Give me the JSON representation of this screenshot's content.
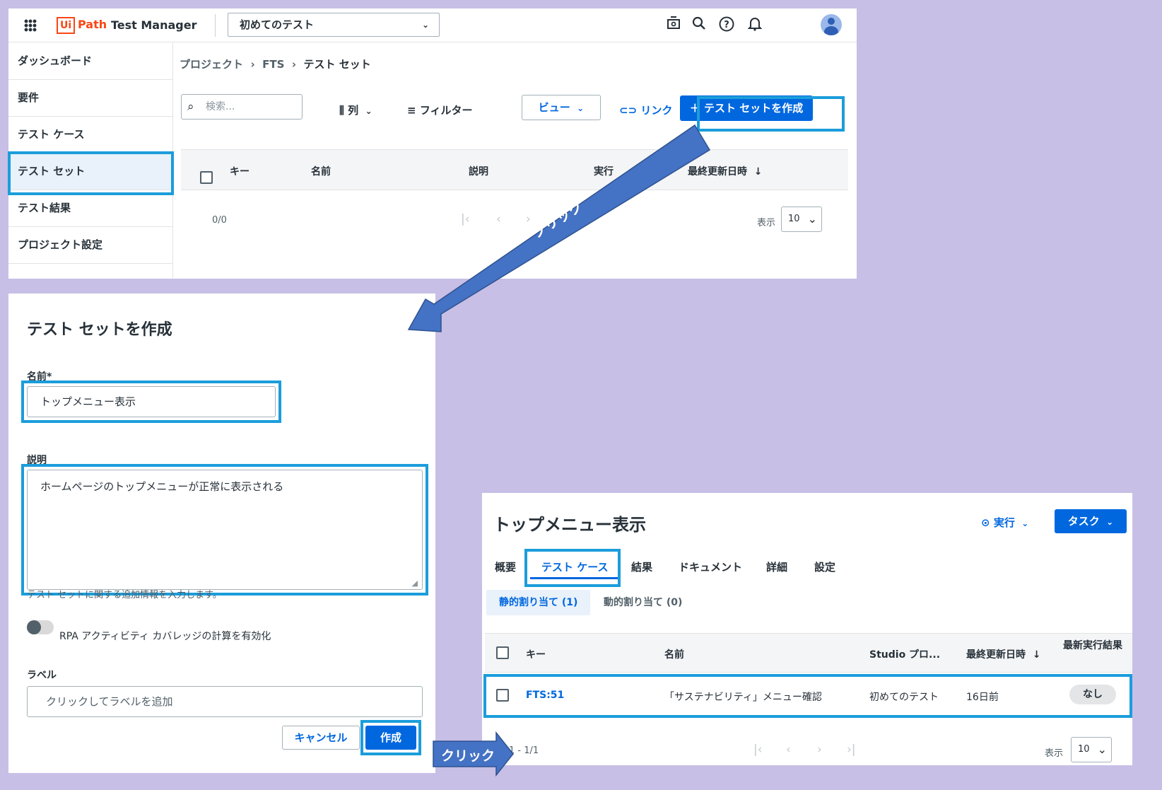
{
  "app": {
    "logo_ui": "Ui",
    "logo_path": "Path",
    "product": "Test Manager",
    "project_select": "初めてのテスト"
  },
  "icons": {
    "apps": "grid-icon",
    "store": "store-icon",
    "search": "search-icon",
    "help": "help-icon",
    "bell": "bell-icon",
    "avatar": "user-avatar-icon"
  },
  "colors": {
    "brand": "#fa4616",
    "primary": "#0067df",
    "highlight": "#1b9ddb",
    "arrow": "#4472c4",
    "background": "#c8bfe6"
  },
  "sidebar": {
    "items": [
      {
        "label": "ダッシュボード"
      },
      {
        "label": "要件"
      },
      {
        "label": "テスト ケース"
      },
      {
        "label": "テスト セット",
        "active": true
      },
      {
        "label": "テスト結果"
      },
      {
        "label": "プロジェクト設定"
      }
    ]
  },
  "testsets_page": {
    "breadcrumb": [
      "プロジェクト",
      "FTS",
      "テスト セット"
    ],
    "search_placeholder": "検索...",
    "columns_label": "列",
    "filter_label": "フィルター",
    "view_label": "ビュー",
    "link_label": "リンク",
    "create_label": "テスト セットを作成",
    "table_headers": [
      "キー",
      "名前",
      "説明",
      "実行",
      "最終更新日時"
    ],
    "pagination": {
      "range": "0/0",
      "rows_label": "表示",
      "rows_value": "10"
    }
  },
  "create_dialog": {
    "title": "テスト セットを作成",
    "name_label": "名前*",
    "name_value": "トップメニュー表示",
    "description_label": "説明",
    "description_value": "ホームページのトップメニューが正常に表示される",
    "description_hint": "テスト セットに関する追加情報を入力します。",
    "toggle_label": "RPA アクティビティ カバレッジの計算を有効化",
    "labels_label": "ラベル",
    "labels_placeholder": "クリックしてラベルを追加",
    "cancel_label": "キャンセル",
    "submit_label": "作成"
  },
  "testset_detail": {
    "title": "トップメニュー表示",
    "run_label": "実行",
    "task_label": "タスク",
    "tabs": [
      "概要",
      "テスト ケース",
      "結果",
      "ドキュメント",
      "詳細",
      "設定"
    ],
    "active_tab": "テスト ケース",
    "static_chip": "静的割り当て (1)",
    "dynamic_chip": "動的割り当て (0)",
    "table_headers": [
      "キー",
      "名前",
      "Studio プロ...",
      "最終更新日時",
      "最新実行結果"
    ],
    "rows": [
      {
        "key": "FTS:51",
        "name": "「サステナビリティ」メニュー確認",
        "studio_project": "初めてのテスト",
        "updated": "16日前",
        "last_result": "なし"
      }
    ],
    "pagination": {
      "range": "1 - 1/1",
      "rows_label": "表示",
      "rows_value": "10"
    }
  },
  "annotations": {
    "click_1": "クリック",
    "click_2": "クリック"
  }
}
